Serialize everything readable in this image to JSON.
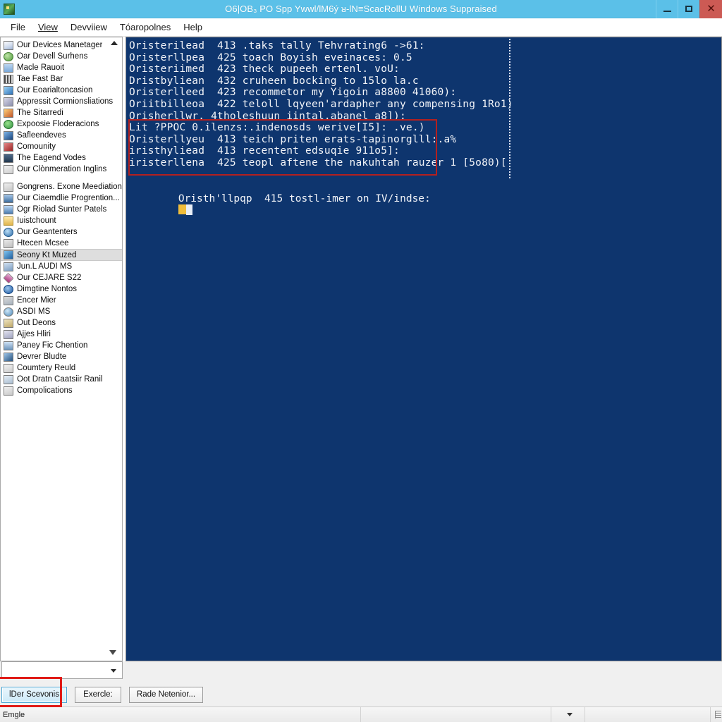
{
  "window": {
    "title": "O6|OB₃ PO Spp Ywwl/lM6ý ᴚ-lN≡ScacRollU Windows Suppraised",
    "icon": "app-shield-icon",
    "controls": {
      "minimize": "–",
      "maximize": "□",
      "close": "✕"
    },
    "colors": {
      "titlebar": "#5bc0e8",
      "close_button": "#cc5a54",
      "console_background": "#0e356e",
      "highlight_box": "#b4201f",
      "button_highlight_box": "#e01b17",
      "focus_button": "#cdeaf8"
    }
  },
  "menubar": {
    "items": [
      {
        "label": "File"
      },
      {
        "label": "View"
      },
      {
        "label": "Devviiew"
      },
      {
        "label": "Tóaropolnes"
      },
      {
        "label": "Help"
      }
    ]
  },
  "sidebar": {
    "scroll_up": "▲",
    "scroll_down": "▼",
    "items": [
      {
        "label": "Our Devices Manetager",
        "icon": "computer-icon",
        "selected": false,
        "spacer_after": false
      },
      {
        "label": "Oar Devell Surhens",
        "icon": "globe-icon",
        "selected": false,
        "spacer_after": false
      },
      {
        "label": "Macle Rauoit",
        "icon": "monitor-icon",
        "selected": false,
        "spacer_after": false
      },
      {
        "label": "Tae Fast Bar",
        "icon": "keyboard-icon",
        "selected": false,
        "spacer_after": false
      },
      {
        "label": "Our Eoarialtoncasion",
        "icon": "pen-icon",
        "selected": false,
        "spacer_after": false
      },
      {
        "label": "Appressit Cormionsliations",
        "icon": "chip-icon",
        "selected": false,
        "spacer_after": false
      },
      {
        "label": "The Sitarredi",
        "icon": "image-icon",
        "selected": false,
        "spacer_after": false
      },
      {
        "label": "Expoosie Floderacions",
        "icon": "disc-icon",
        "selected": false,
        "spacer_after": false
      },
      {
        "label": "Safleendeves",
        "icon": "info-icon",
        "selected": false,
        "spacer_after": false
      },
      {
        "label": "Comounity",
        "icon": "network-icon",
        "selected": false,
        "spacer_after": false
      },
      {
        "label": "The Eagend Vodes",
        "icon": "display-icon",
        "selected": false,
        "spacer_after": false
      },
      {
        "label": "Our Clònmeration Inglins",
        "icon": "document-icon",
        "selected": false,
        "spacer_after": true
      },
      {
        "label": "Gongrens. Exone Meediation",
        "icon": "folder-icon",
        "selected": false,
        "spacer_after": false
      },
      {
        "label": "Our Ciaemdlie Progrention...",
        "icon": "folder-blue-icon",
        "selected": false,
        "spacer_after": false
      },
      {
        "label": "Ogr Riolad Sunter Patels",
        "icon": "screen-icon",
        "selected": false,
        "spacer_after": false
      },
      {
        "label": "Iuistchount",
        "icon": "folder-yellow-icon",
        "selected": false,
        "spacer_after": false
      },
      {
        "label": "Our Geantenters",
        "icon": "globe-small-icon",
        "selected": false,
        "spacer_after": false
      },
      {
        "label": "Htecen Mcsee",
        "icon": "page-icon",
        "selected": false,
        "spacer_after": false
      },
      {
        "label": "Seony Kt Muzed",
        "icon": "badge-icon",
        "selected": true,
        "spacer_after": false
      },
      {
        "label": "Jun.L AUDI MS",
        "icon": "card-icon",
        "selected": false,
        "spacer_after": false
      },
      {
        "label": "Our CEJARE S22",
        "icon": "diamond-icon",
        "selected": false,
        "spacer_after": false
      },
      {
        "label": "Dimgtine Nontos",
        "icon": "blue-ball-icon",
        "selected": false,
        "spacer_after": false
      },
      {
        "label": "Encer Mier",
        "icon": "window-icon",
        "selected": false,
        "spacer_after": false
      },
      {
        "label": "ASDI MS",
        "icon": "globe-node-icon",
        "selected": false,
        "spacer_after": false
      },
      {
        "label": "Out Deons",
        "icon": "tan-box-icon",
        "selected": false,
        "spacer_after": false
      },
      {
        "label": "Ajjes Hliri",
        "icon": "grey-box-icon",
        "selected": false,
        "spacer_after": false
      },
      {
        "label": "Paney Fic Chention",
        "icon": "panel-icon",
        "selected": false,
        "spacer_after": false
      },
      {
        "label": "Devrer Bludte",
        "icon": "device-icon",
        "selected": false,
        "spacer_after": false
      },
      {
        "label": "Coumtery Reuld",
        "icon": "printer-icon",
        "selected": false,
        "spacer_after": false
      },
      {
        "label": "Oot Dratn Caatsiir Ranil",
        "icon": "drive-icon",
        "selected": false,
        "spacer_after": false
      },
      {
        "label": "Compolications",
        "icon": "list-icon",
        "selected": false,
        "spacer_after": false
      }
    ]
  },
  "console": {
    "lines": [
      "Oristerilead  413 .taks tally Tehvrating6 ->61:",
      "Oristerllpea  425 toach Boyish eveinaces: 0.5",
      "Oristeriimed  423 theck pupeeh ertenl. voU:",
      "Dristbyliean  432 cruheen bocking to 15lo la.c",
      "Oristerlleed  423 recommetor my Yigoin a8800 41060):",
      "Oriitbilleoa  422 teloll lqyeen'ardapher any compensing 1Ro1)",
      "Orisherllwr. 4tholeshuun iintal.abanel a8]):",
      "Lit ?PPOC 0.ilenzs:.indenosds werive[I5]: .ve.)",
      "Oristerllyeu  413 teich priten erats-tapinorglll:.a%",
      "iristhyliead  413 recentent edsuqie 911o5]:",
      "iristerllena  425 teopl aftene the nakuhtah rauzer 1 [5o80)["
    ],
    "cursor_line": "Oristh'llpqp  415 tostl-imer on IV/indse:",
    "highlight_region": {
      "start_line_index": 7,
      "line_count": 4
    },
    "cursor_blocks": [
      "yellow-block",
      "white-block"
    ]
  },
  "bottom": {
    "combo": {
      "value": "",
      "caret": "▼"
    },
    "buttons": [
      {
        "label": "lDer Scevonis",
        "focused": true,
        "highlighted": true
      },
      {
        "label": "Exercle:",
        "focused": false,
        "highlighted": false
      },
      {
        "label": "Rade Netenior...",
        "focused": false,
        "highlighted": false
      }
    ]
  },
  "statusbar": {
    "message": "Emgle",
    "middle": "",
    "caret": "▼",
    "rest": "",
    "grip": "resize-grip"
  }
}
